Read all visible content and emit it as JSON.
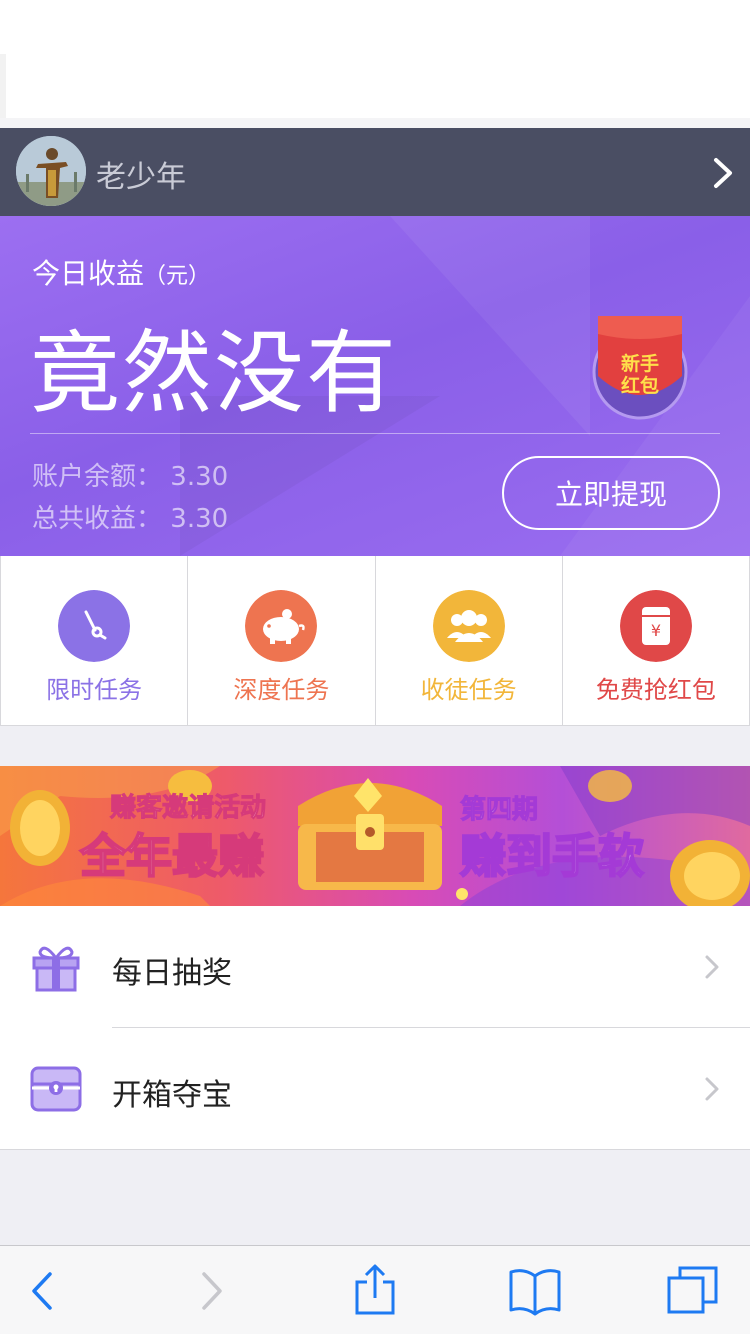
{
  "user": {
    "name": "老少年"
  },
  "earnings": {
    "title": "今日收益",
    "unit": "（元）",
    "amount": "竟然没有",
    "redpacket_text": [
      "新手",
      "红包"
    ],
    "balance_label": "账户余额：",
    "balance_value": "3.30",
    "total_label": "总共收益：",
    "total_value": "3.30",
    "withdraw_button": "立即提现"
  },
  "tasks": [
    {
      "label": "限时任务",
      "color": "#8b72e6",
      "icon": "clock-icon"
    },
    {
      "label": "深度任务",
      "color": "#ee7450",
      "icon": "piggy-bank-icon"
    },
    {
      "label": "收徒任务",
      "color": "#f2b63a",
      "icon": "users-icon"
    },
    {
      "label": "免费抢红包",
      "color": "#e04848",
      "icon": "red-envelope-icon"
    }
  ],
  "banner": {
    "line1_left": "赚客邀请活动",
    "line2_left": "全年最赚",
    "line1_right": "第四期",
    "line2_right": "赚到手软"
  },
  "menu": [
    {
      "label": "每日抽奖",
      "icon": "gift-icon"
    },
    {
      "label": "开箱夺宝",
      "icon": "treasure-box-icon"
    }
  ],
  "colors": {
    "accent": "#9b6cf0",
    "header_bar": "#4a4e63",
    "safari_blue": "#1e7af2"
  }
}
